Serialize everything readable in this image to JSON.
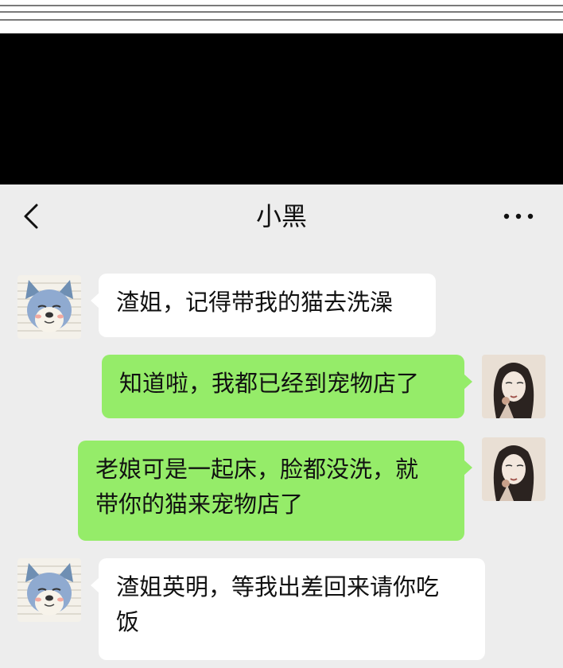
{
  "chat": {
    "title": "小黑"
  },
  "messages": [
    {
      "side": "left",
      "avatar": "husky-dog-avatar",
      "lines": [
        "渣姐，记得带我的猫去洗澡"
      ]
    },
    {
      "side": "right",
      "avatar": "woman-portrait-avatar",
      "lines": [
        "知道啦，我都已经到宠物店了"
      ]
    },
    {
      "side": "right",
      "avatar": "woman-portrait-avatar",
      "lines": [
        "老娘可是一起床，脸都没洗，就",
        "带你的猫来宠物店了"
      ]
    },
    {
      "side": "left",
      "avatar": "husky-dog-avatar",
      "lines": [
        "渣姐英明，等我出差回来请你吃",
        "饭"
      ]
    }
  ],
  "colors": {
    "background": "#ededed",
    "incoming_bubble": "#ffffff",
    "outgoing_bubble": "#95ec69",
    "header_band": "#000000"
  },
  "icons": {
    "back": "chevron-left-icon",
    "more": "more-dots-icon"
  }
}
